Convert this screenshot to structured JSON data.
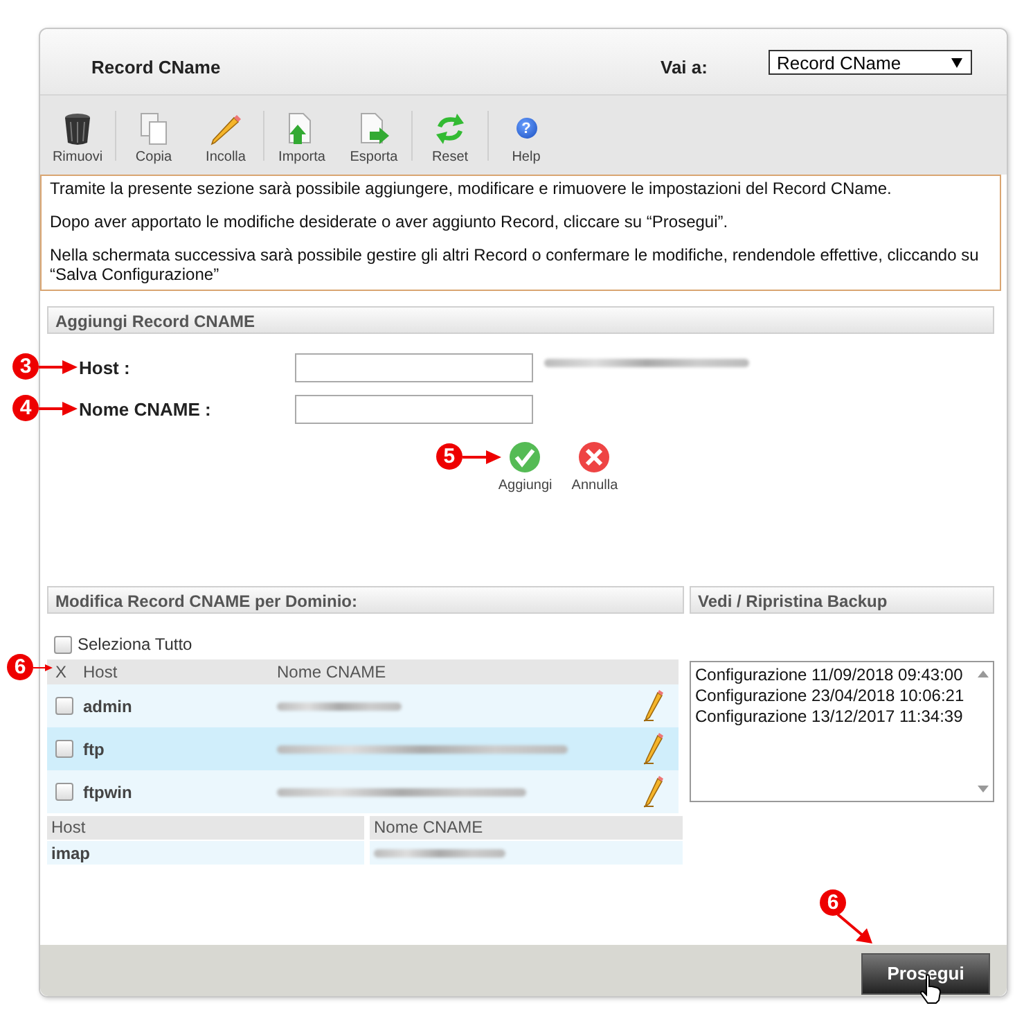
{
  "header": {
    "title": "Record CName",
    "goto_label": "Vai a:",
    "goto_value": "Record CName"
  },
  "toolbar": [
    [
      {
        "label": "Rimuovi",
        "kind": "trash"
      }
    ],
    [
      {
        "label": "Copia",
        "kind": "copy"
      },
      {
        "label": "Incolla",
        "kind": "pencil"
      }
    ],
    [
      {
        "label": "Importa",
        "kind": "import"
      },
      {
        "label": "Esporta",
        "kind": "export"
      }
    ],
    [
      {
        "label": "Reset",
        "kind": "reset"
      }
    ],
    [
      {
        "label": "Help",
        "kind": "help",
        "glyph": "?"
      }
    ]
  ],
  "info": [
    "Tramite la presente sezione sarà possibile aggiungere, modificare e rimuovere le impostazioni del Record CName.",
    "Dopo aver apportato le modifiche desiderate o aver aggiunto Record, cliccare su “Prosegui”.",
    "Nella schermata successiva sarà possibile gestire gli altri Record o confermare le modifiche, rendendole effettive, cliccando su “Salva Configurazione”"
  ],
  "add_section": {
    "title": "Aggiungi Record CNAME",
    "fields": [
      {
        "label": "Host :",
        "annotation": "3",
        "blurred_hint": true
      },
      {
        "label": "Nome CNAME :",
        "annotation": "4",
        "blurred_hint": false
      }
    ],
    "buttons": [
      {
        "label": "Aggiungi",
        "kind": "ok",
        "annotation": "5"
      },
      {
        "label": "Annulla",
        "kind": "cancel"
      }
    ]
  },
  "edit_section": {
    "title": "Modifica Record CNAME per Dominio:",
    "select_all": {
      "label": "Seleziona Tutto",
      "checked": false
    },
    "annotation": "6",
    "columns": [
      "X",
      "Host",
      "Nome CNAME"
    ],
    "rows": [
      {
        "host": "admin",
        "checked": false,
        "highlighted": false
      },
      {
        "host": "ftp",
        "checked": false,
        "highlighted": true
      },
      {
        "host": "ftpwin",
        "checked": false,
        "highlighted": false
      }
    ],
    "fixed_columns": [
      "Host",
      "Nome CNAME"
    ],
    "fixed_rows": [
      {
        "host": "imap"
      }
    ]
  },
  "backup_section": {
    "title": "Vedi / Ripristina Backup",
    "items": [
      "Configurazione 11/09/2018 09:43:00",
      "Configurazione 23/04/2018 10:06:21",
      "Configurazione 13/12/2017 11:34:39"
    ]
  },
  "footer": {
    "button": "Prosegui",
    "annotation": "6"
  }
}
